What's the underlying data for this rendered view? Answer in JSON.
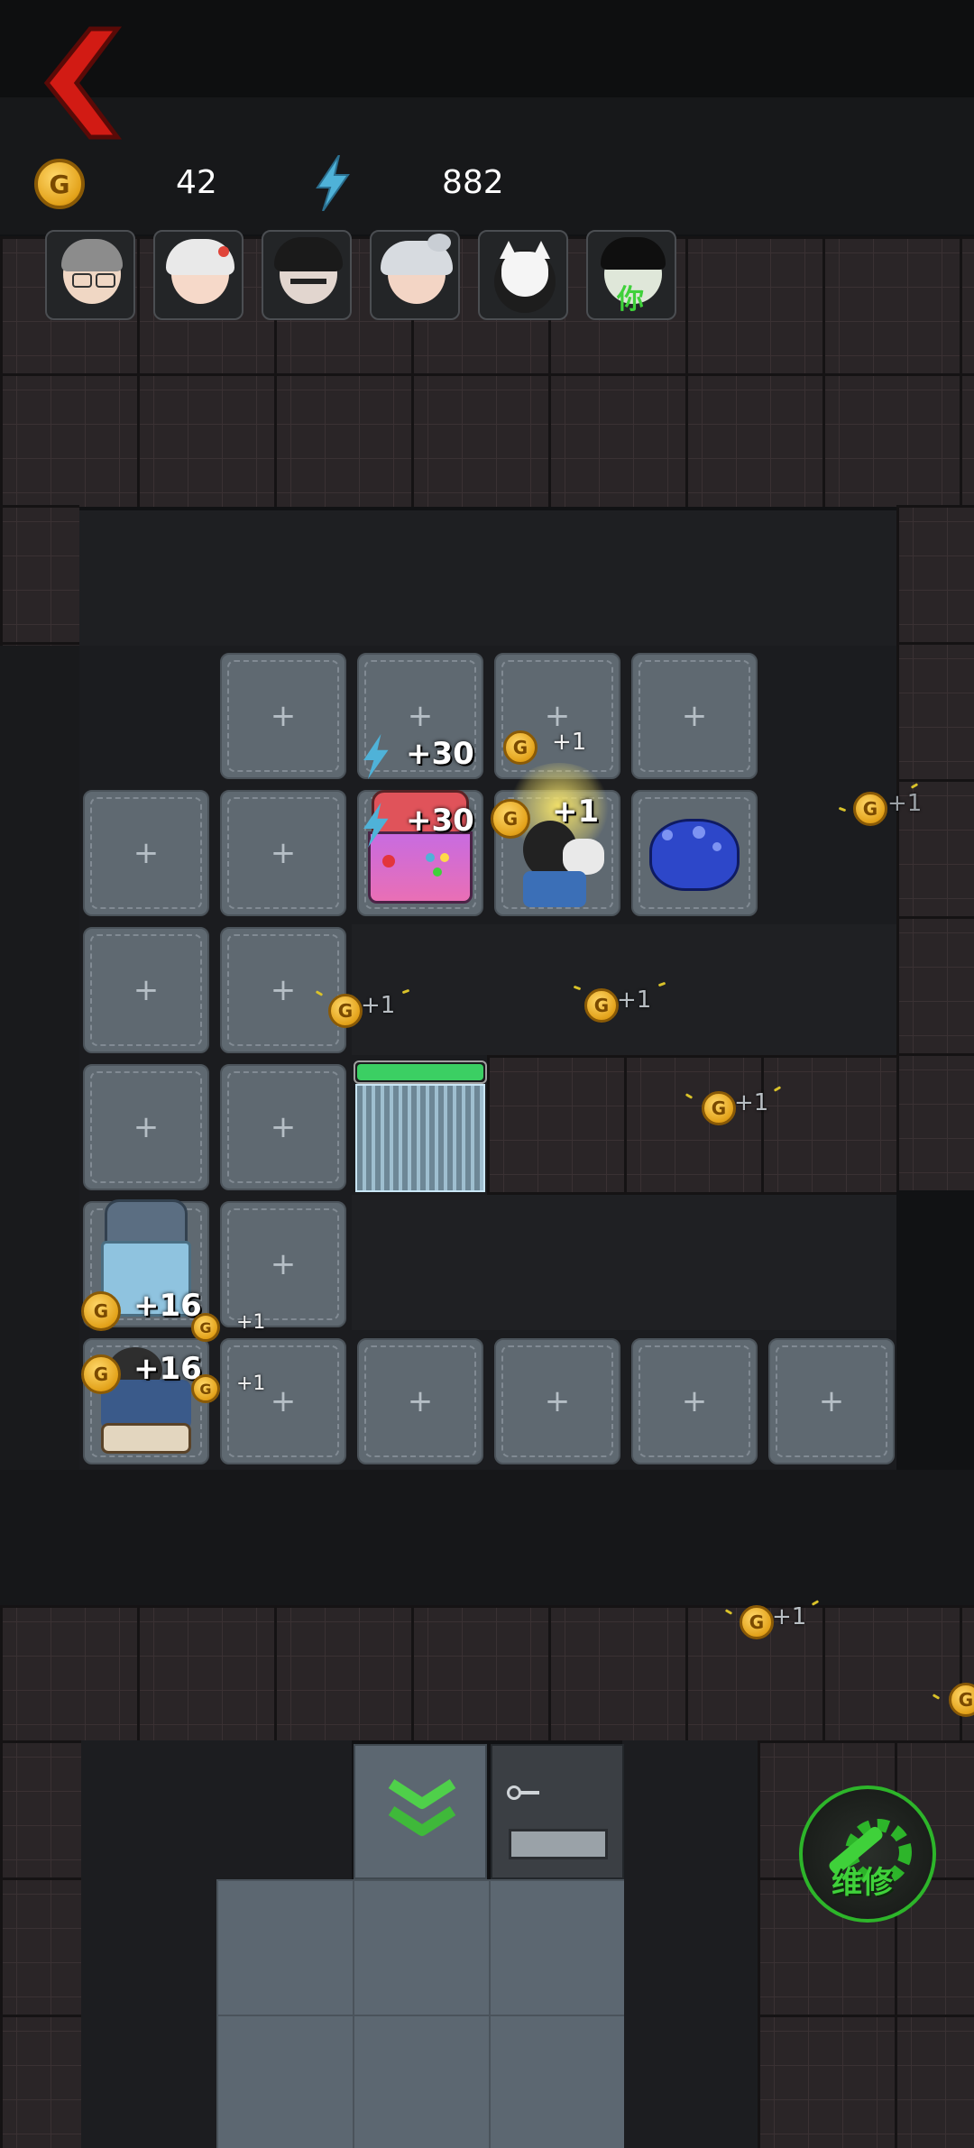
{
  "hud": {
    "gold_icon": "gold-coin-icon",
    "gold": "42",
    "energy_icon": "lightning-icon",
    "energy": "882",
    "back_icon": "red-back-arrow-icon"
  },
  "characters": [
    {
      "name": "grandma-glasses-avatar",
      "hair": "#8c8c8c",
      "skin": "#f0d7c4"
    },
    {
      "name": "white-hair-girl-avatar",
      "hair": "#e9e9e9",
      "skin": "#f6d9c9"
    },
    {
      "name": "dark-hair-man-avatar",
      "hair": "#1a1a1a",
      "skin": "#e2d6cf"
    },
    {
      "name": "old-lady-bun-avatar",
      "hair": "#d7dbe0",
      "skin": "#f3d5c5"
    },
    {
      "name": "fox-mask-avatar",
      "hair": "#1d1d1d",
      "skin": "#f5f5f5"
    },
    {
      "name": "you-player-avatar",
      "hair": "#0f0f0f",
      "skin": "#dfe7d9",
      "label": "你"
    }
  ],
  "floating_gains": {
    "energy_a": "+30",
    "energy_b": "+30",
    "gold_a": "+16",
    "gold_b": "+16",
    "small": "+1",
    "coin_letter": "G"
  },
  "repair_button": {
    "label": "维修",
    "icon": "wrench-gear-icon"
  },
  "door_progress": 1.0,
  "colors": {
    "accent_red": "#d21b14",
    "energy_blue": "#4fb2d8",
    "gold": "#e3a21a",
    "repair_green": "#2db52a"
  }
}
